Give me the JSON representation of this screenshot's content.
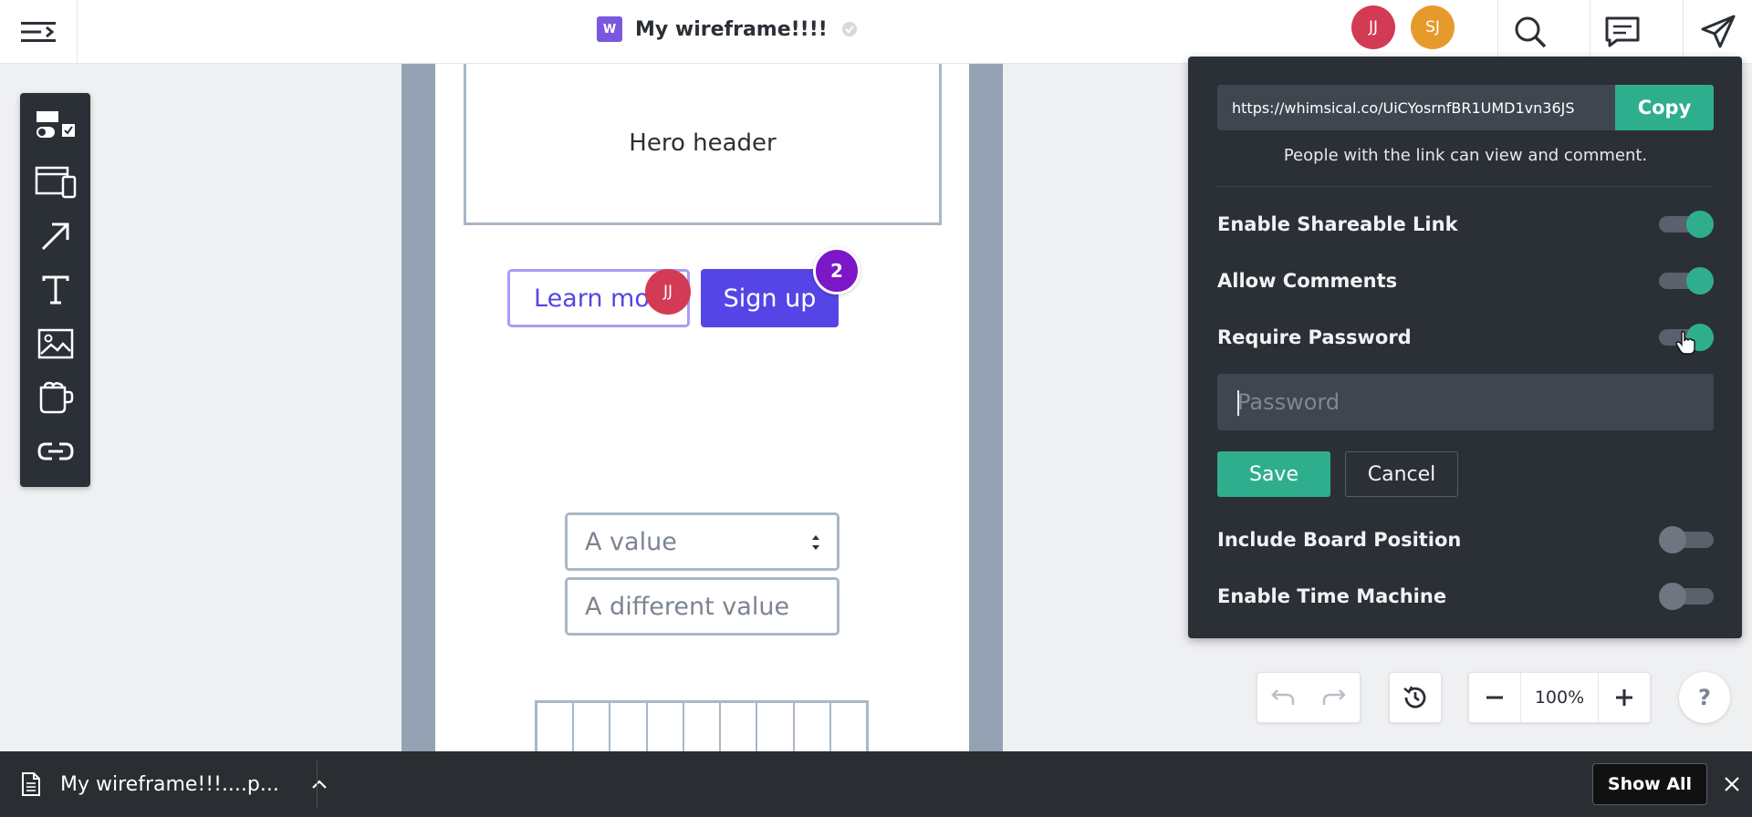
{
  "header": {
    "doc_badge": "W",
    "doc_title": "My wireframe!!!!",
    "avatars": [
      {
        "initials": "JJ",
        "color": "#d33a54"
      },
      {
        "initials": "SJ",
        "color": "#e79a2c"
      }
    ],
    "icons": [
      "menu-icon",
      "verified-icon",
      "search-icon",
      "comments-icon",
      "share-icon"
    ]
  },
  "toolbar": {
    "tools": [
      {
        "name": "ui-components-icon"
      },
      {
        "name": "device-frames-icon"
      },
      {
        "name": "arrow-icon"
      },
      {
        "name": "text-icon"
      },
      {
        "name": "image-icon"
      },
      {
        "name": "cup-icon"
      },
      {
        "name": "link-icon"
      }
    ]
  },
  "canvas": {
    "hero_header": "Hero header",
    "learn_more": "Learn more",
    "sign_up": "Sign up",
    "cursor_avatar": "JJ",
    "comment_count": "2",
    "select_value": "A value",
    "input_value": "A different value"
  },
  "share_panel": {
    "link": "https://whimsical.co/UiCYosrnfBR1UMD1vn36JS",
    "copy_label": "Copy",
    "note": "People with the link can view and comment.",
    "options": [
      {
        "label": "Enable Shareable Link",
        "on": true
      },
      {
        "label": "Allow Comments",
        "on": true
      },
      {
        "label": "Require Password",
        "on": true
      },
      {
        "label": "Include Board Position",
        "on": false
      },
      {
        "label": "Enable Time Machine",
        "on": false
      }
    ],
    "password_placeholder": "Password",
    "save_label": "Save",
    "cancel_label": "Cancel",
    "accent": "#2fae8e"
  },
  "controls": {
    "zoom": "100%",
    "help": "?"
  },
  "downloads": {
    "file_name": "My wireframe!!!....p...",
    "show_all": "Show All"
  }
}
